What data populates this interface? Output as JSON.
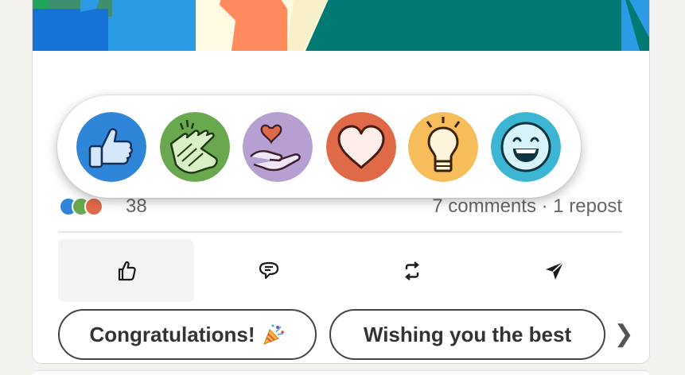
{
  "colors": {
    "like": "#2f86d8",
    "celebrate": "#6aa84f",
    "support": "#b6a0d2",
    "love": "#df6a48",
    "insightful": "#f7bd5a",
    "funny": "#3db6d4"
  },
  "reactions": [
    {
      "name": "like",
      "icon": "thumbs-up-icon"
    },
    {
      "name": "celebrate",
      "icon": "clapping-hands-icon"
    },
    {
      "name": "support",
      "icon": "heart-in-hand-icon"
    },
    {
      "name": "love",
      "icon": "heart-icon"
    },
    {
      "name": "insightful",
      "icon": "lightbulb-icon"
    },
    {
      "name": "funny",
      "icon": "laughing-face-icon"
    }
  ],
  "stats": {
    "count": "38",
    "comments_reposts": "7 comments · 1 repost"
  },
  "actions": [
    {
      "name": "like",
      "icon": "thumbs-up-outline-icon"
    },
    {
      "name": "comment",
      "icon": "comment-icon"
    },
    {
      "name": "repost",
      "icon": "repost-icon"
    },
    {
      "name": "send",
      "icon": "send-icon"
    }
  ],
  "suggestions": {
    "first": "Congratulations!",
    "first_emoji": "party-popper-icon",
    "second": "Wishing you the best",
    "next": "❯"
  }
}
